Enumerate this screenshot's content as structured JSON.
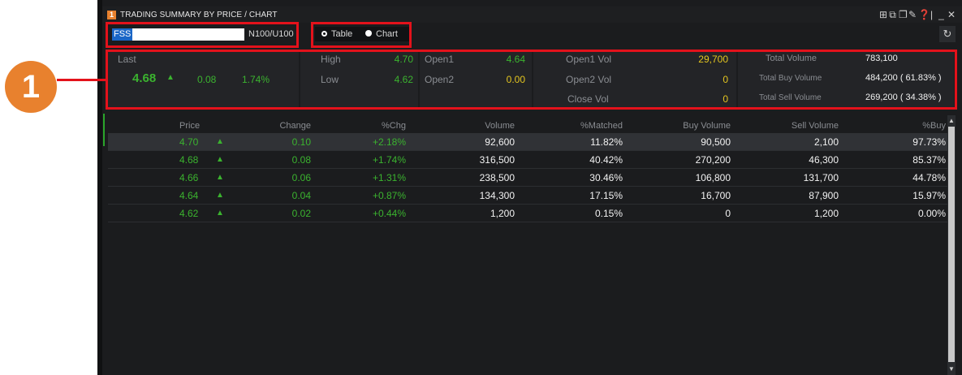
{
  "window": {
    "number": "1",
    "title": "TRADING SUMMARY BY PRICE / CHART",
    "icons": [
      "grid-icon",
      "external-icon",
      "copy-icon",
      "pin-icon",
      "help-icon",
      "minimize-icon",
      "close-icon"
    ]
  },
  "toolbar": {
    "symbol_value": "FSS",
    "board_label": "N100/U100",
    "radio_table": "Table",
    "radio_chart": "Chart",
    "selected_view": "Table"
  },
  "summary": {
    "last_label": "Last",
    "last_value": "4.68",
    "last_change": "0.08",
    "last_pct": "1.74%",
    "high_label": "High",
    "high_value": "4.70",
    "low_label": "Low",
    "low_value": "4.62",
    "open1_label": "Open1",
    "open1_value": "4.64",
    "open2_label": "Open2",
    "open2_value": "0.00",
    "open1_vol_label": "Open1 Vol",
    "open1_vol_value": "29,700",
    "open2_vol_label": "Open2 Vol",
    "open2_vol_value": "0",
    "close_vol_label": "Close Vol",
    "close_vol_value": "0",
    "total_volume_label": "Total Volume",
    "total_volume_value": "783,100",
    "total_buy_label": "Total Buy Volume",
    "total_buy_value": "484,200 ( 61.83% )",
    "total_sell_label": "Total Sell Volume",
    "total_sell_value": "269,200 ( 34.38% )"
  },
  "annotation": {
    "badge_number": "1"
  },
  "table": {
    "headers": {
      "price": "Price",
      "change": "Change",
      "pct_chg": "%Chg",
      "volume": "Volume",
      "matched": "%Matched",
      "buy_volume": "Buy Volume",
      "sell_volume": "Sell Volume",
      "pct_buy": "%Buy"
    },
    "rows": [
      {
        "price": "4.70",
        "arrow": "▲",
        "change": "0.10",
        "pct_chg": "+2.18%",
        "volume": "92,600",
        "matched": "11.82%",
        "buy_volume": "90,500",
        "sell_volume": "2,100",
        "pct_buy": "97.73%"
      },
      {
        "price": "4.68",
        "arrow": "▲",
        "change": "0.08",
        "pct_chg": "+1.74%",
        "volume": "316,500",
        "matched": "40.42%",
        "buy_volume": "270,200",
        "sell_volume": "46,300",
        "pct_buy": "85.37%"
      },
      {
        "price": "4.66",
        "arrow": "▲",
        "change": "0.06",
        "pct_chg": "+1.31%",
        "volume": "238,500",
        "matched": "30.46%",
        "buy_volume": "106,800",
        "sell_volume": "131,700",
        "pct_buy": "44.78%"
      },
      {
        "price": "4.64",
        "arrow": "▲",
        "change": "0.04",
        "pct_chg": "+0.87%",
        "volume": "134,300",
        "matched": "17.15%",
        "buy_volume": "16,700",
        "sell_volume": "87,900",
        "pct_buy": "15.97%"
      },
      {
        "price": "4.62",
        "arrow": "▲",
        "change": "0.02",
        "pct_chg": "+0.44%",
        "volume": "1,200",
        "matched": "0.15%",
        "buy_volume": "0",
        "sell_volume": "1,200",
        "pct_buy": "0.00%"
      }
    ]
  },
  "colors": {
    "up_green": "#3bb32f",
    "yellow": "#e3c51f",
    "annotation_red": "#e3121b",
    "callout_orange": "#e8812e"
  }
}
